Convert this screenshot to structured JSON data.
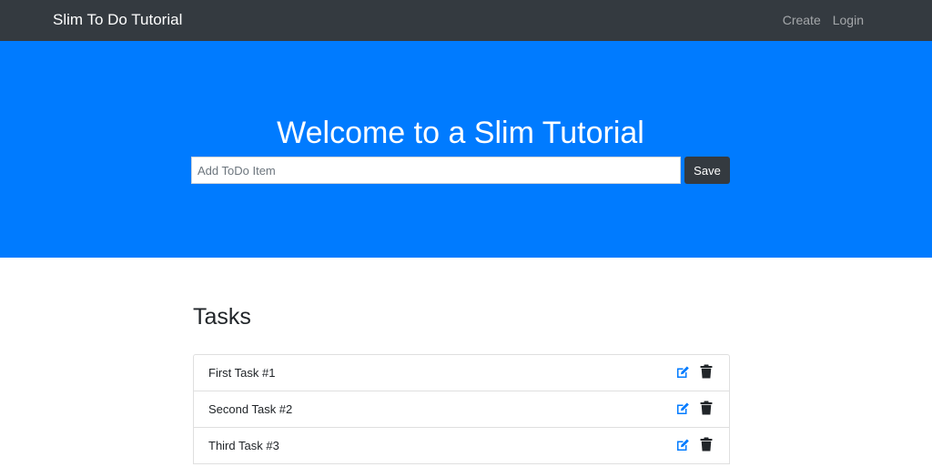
{
  "navbar": {
    "brand": "Slim To Do Tutorial",
    "links": [
      "Create",
      "Login"
    ]
  },
  "hero": {
    "title": "Welcome to a Slim Tutorial",
    "input_placeholder": "Add ToDo Item",
    "input_value": "",
    "save_label": "Save"
  },
  "tasks": {
    "heading": "Tasks",
    "items": [
      {
        "label": "First Task #1",
        "edit_icon": "edit-icon",
        "delete_icon": "trash-icon"
      },
      {
        "label": "Second Task #2",
        "edit_icon": "edit-icon",
        "delete_icon": "trash-icon"
      },
      {
        "label": "Third Task #3",
        "edit_icon": "edit-icon",
        "delete_icon": "trash-icon"
      }
    ]
  },
  "colors": {
    "navbar": "#343a40",
    "hero": "#007bff",
    "edit_icon": "#007bff",
    "trash_icon": "#212529",
    "save_button": "#343a40"
  }
}
